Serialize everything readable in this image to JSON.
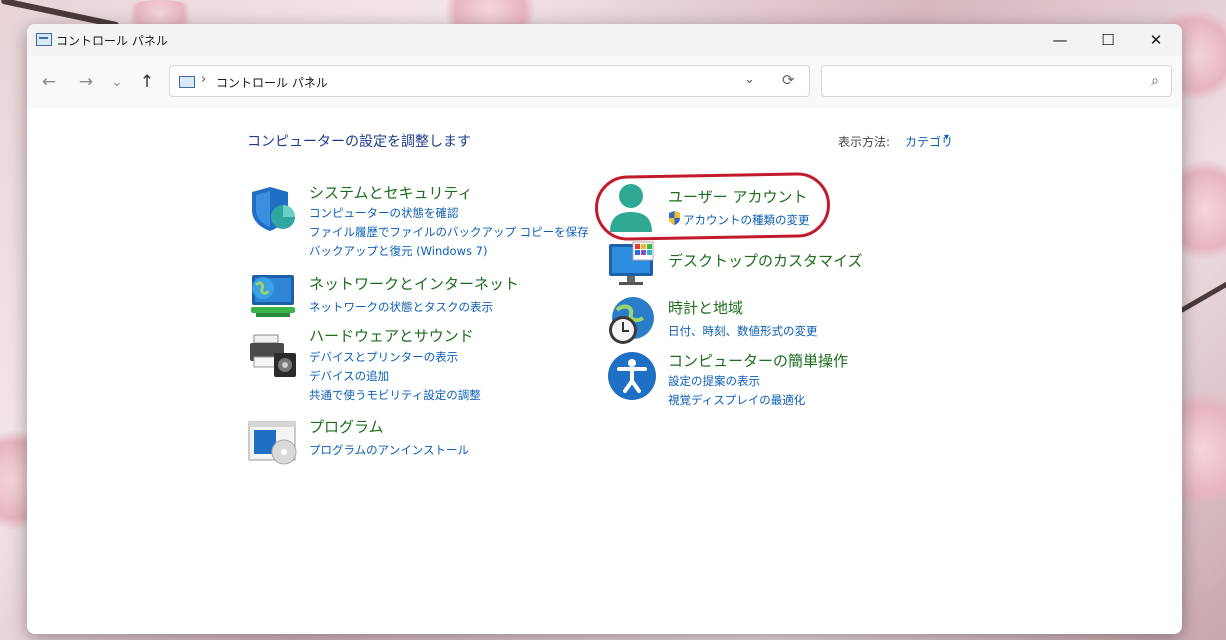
{
  "window": {
    "title": "コントロール パネル",
    "controls": {
      "minimize": "—",
      "maximize": "☐",
      "close": "✕"
    }
  },
  "nav": {
    "back": "←",
    "forward": "→",
    "recent": "⌄",
    "up": "↑",
    "breadcrumb": "コントロール パネル",
    "separator": "›",
    "dropdown": "⌄",
    "refresh": "⟳",
    "search_placeholder": "",
    "search_icon": "⌕"
  },
  "content": {
    "heading": "コンピューターの設定を調整します",
    "view_by_label": "表示方法:",
    "view_by_value": "カテゴリ",
    "caret": "▾"
  },
  "categories_left": [
    {
      "title": "システムとセキュリティ",
      "icon": "shield-icon",
      "links": [
        "コンピューターの状態を確認",
        "ファイル履歴でファイルのバックアップ コピーを保存",
        "バックアップと復元 (Windows 7)"
      ]
    },
    {
      "title": "ネットワークとインターネット",
      "icon": "network-globe-icon",
      "links": [
        "ネットワークの状態とタスクの表示"
      ]
    },
    {
      "title": "ハードウェアとサウンド",
      "icon": "printer-speaker-icon",
      "links": [
        "デバイスとプリンターの表示",
        "デバイスの追加",
        "共通で使うモビリティ設定の調整"
      ]
    },
    {
      "title": "プログラム",
      "icon": "programs-disc-icon",
      "links": [
        "プログラムのアンインストール"
      ]
    }
  ],
  "categories_right": [
    {
      "title": "ユーザー アカウント",
      "icon": "user-icon",
      "links": [
        "アカウントの種類の変更"
      ]
    },
    {
      "title": "デスクトップのカスタマイズ",
      "icon": "monitor-icon",
      "links": []
    },
    {
      "title": "時計と地域",
      "icon": "clock-globe-icon",
      "links": [
        "日付、時刻、数値形式の変更"
      ]
    },
    {
      "title": "コンピューターの簡単操作",
      "icon": "accessibility-icon",
      "links": [
        "設定の提案の表示",
        "視覚ディスプレイの最適化"
      ]
    }
  ],
  "colors": {
    "category_title": "#1c6e1c",
    "link": "#0b5fb5",
    "heading": "#1e3c8c",
    "highlight": "#c11b2b"
  }
}
